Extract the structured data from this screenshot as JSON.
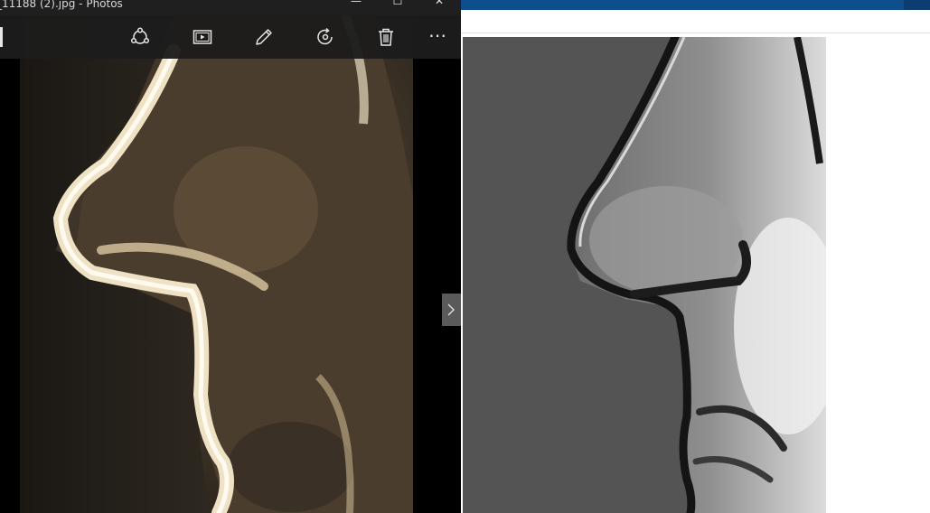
{
  "photos_window": {
    "title": "_11188 (2).jpg - Photos",
    "window_controls": {
      "minimize": "—",
      "maximize": "☐",
      "close": "✕"
    },
    "toolbar": {
      "items": [
        {
          "name": "share-icon"
        },
        {
          "name": "slideshow-icon"
        },
        {
          "name": "edit-pencil-icon"
        },
        {
          "name": "rotate-icon"
        },
        {
          "name": "delete-icon"
        },
        {
          "name": "more-options-icon",
          "label": "⋯"
        }
      ]
    },
    "next_arrow_icon": "chevron-right-icon"
  },
  "colors": {
    "titlebar": "#1f1f1f",
    "toolbar": "#1c1c1c",
    "accent_blue": "#0f4e8c",
    "photo_warm": "#8a7a60",
    "coin_gray": "#9a9a9a"
  }
}
